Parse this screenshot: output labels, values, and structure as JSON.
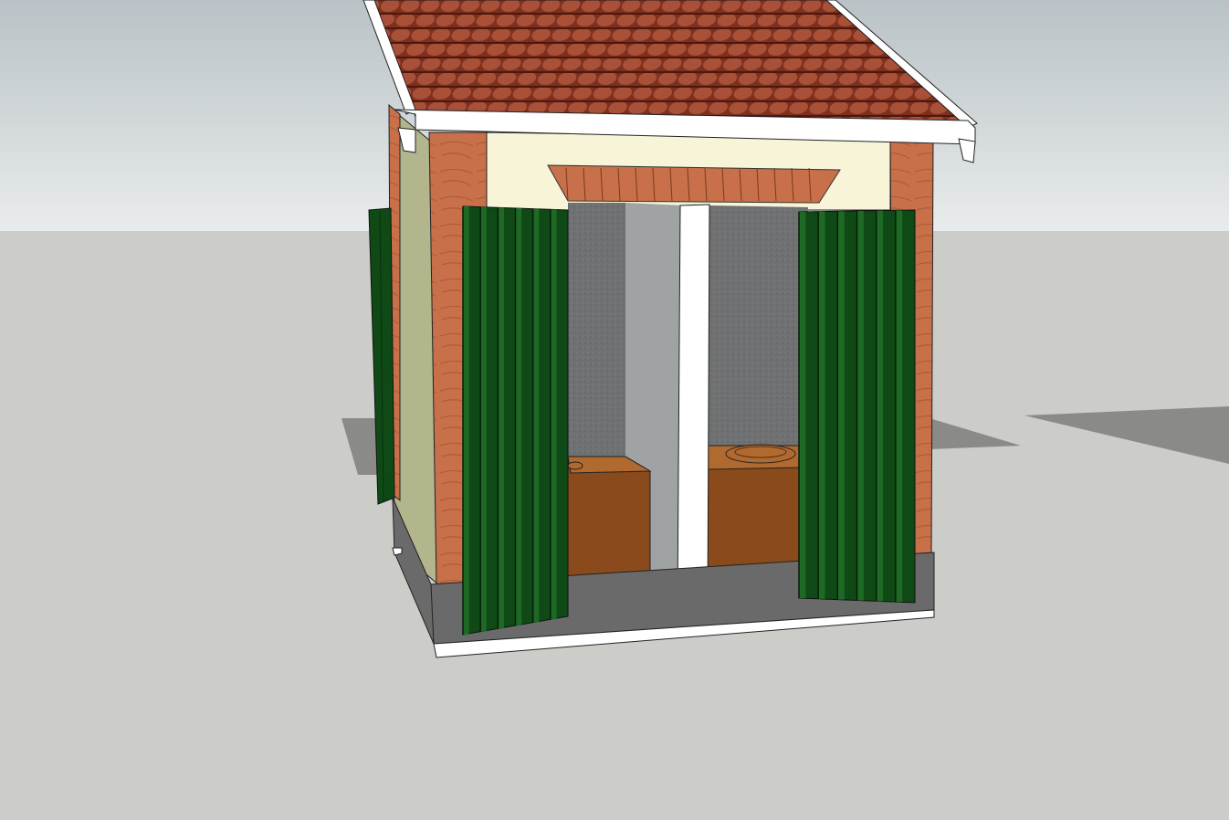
{
  "scene": {
    "subject": "outhouse-model",
    "colors": {
      "sky_top": "#b9c2c6",
      "sky_bottom": "#e9ecec",
      "ground": "#cccdc9",
      "shadow": "#8a8b88",
      "roof_tile": "#7e2f1d",
      "roof_tile_light": "#a85038",
      "fascia": "#ffffff",
      "brick": "#c7704a",
      "brick_dark": "#a4522f",
      "plaster": "#f7f4d8",
      "side_wall": "#b3b58d",
      "shutter": "#0f4a16",
      "shutter_light": "#1e6a24",
      "interior": "#6f7172",
      "interior_light": "#a0a3a4",
      "seat_wood": "#8a4a1c",
      "seat_wood_light": "#b06a30",
      "plinth": "#6a6a6a",
      "divider": "#ffffff"
    }
  }
}
